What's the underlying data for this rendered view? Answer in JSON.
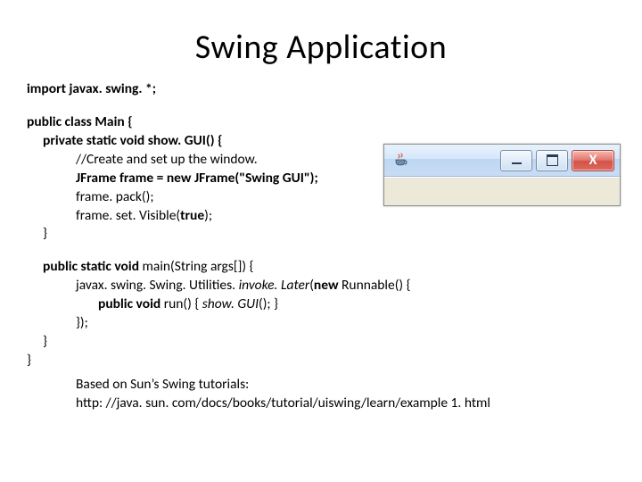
{
  "title": "Swing Application",
  "code": {
    "l0": "import javax. swing. *;",
    "l1": "public class Main {",
    "l2": "private static void show. GUI() {",
    "l3": "//Create and set up the window.",
    "l4": "JFrame frame = new JFrame(\"Swing GUI\");",
    "l5": "frame. pack();",
    "l6": "frame. set. Visible(true);",
    "l7": "}",
    "l8": "public static void main(String args[]) {",
    "l9": "javax. swing. Swing. Utilities. invoke. Later(new Runnable() {",
    "l10": "public void run() { show. GUI(); }",
    "l11": "});",
    "l12": "}",
    "l13": "}"
  },
  "footer": {
    "line1": "Based on Sun’s Swing tutorials:",
    "line2": "http: //java. sun. com/docs/books/tutorial/uiswing/learn/example 1. html"
  },
  "window": {
    "icon": "java-icon",
    "close_glyph": "X"
  }
}
